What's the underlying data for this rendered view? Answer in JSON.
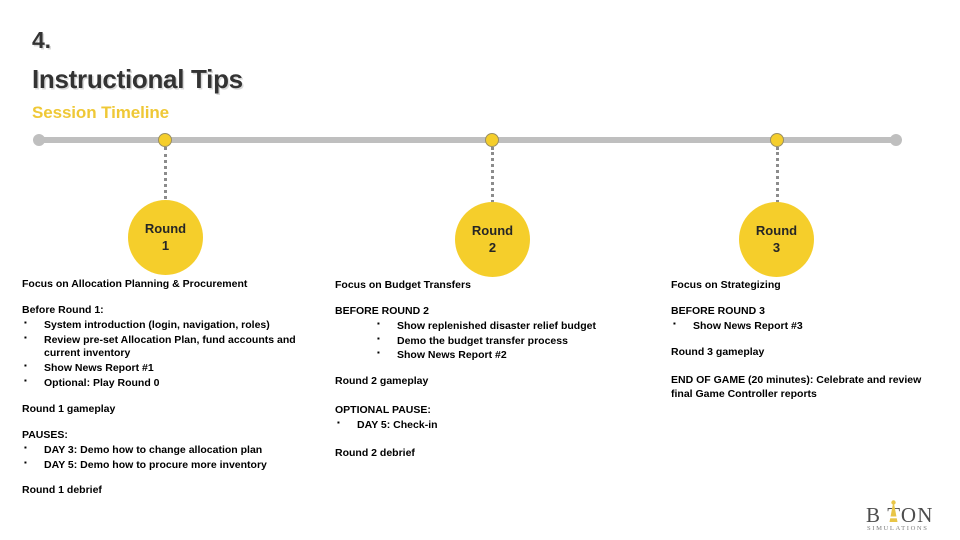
{
  "header": {
    "number": "4.",
    "title": "Instructional Tips",
    "subtitle": "Session Timeline",
    "accent_color": "#EFC836",
    "title_color": "#333333"
  },
  "timeline": {
    "bar_color": "#BFBFBF",
    "node_color": "#F5CE2B",
    "nodes": [
      {
        "label_line1": "Round",
        "label_line2": "1"
      },
      {
        "label_line1": "Round",
        "label_line2": "2"
      },
      {
        "label_line1": "Round",
        "label_line2": "3"
      }
    ]
  },
  "columns": {
    "round1": {
      "focus": "Focus on Allocation Planning & Procurement",
      "before_heading": "Before Round 1:",
      "before_bullets": [
        "System introduction (login, navigation, roles)",
        "Review pre-set Allocation Plan, fund accounts and current inventory",
        "Show News Report #1",
        "Optional: Play Round 0"
      ],
      "gameplay": "Round 1 gameplay",
      "pauses_heading": "PAUSES:",
      "pauses_bullets": [
        "DAY 3: Demo how to change allocation plan",
        "DAY 5: Demo how to procure more inventory"
      ],
      "debrief": "Round 1 debrief"
    },
    "round2": {
      "focus": "Focus on Budget Transfers",
      "before_heading": "BEFORE ROUND 2",
      "before_bullets": [
        "Show replenished disaster relief budget",
        "Demo the budget transfer process",
        "Show News Report #2"
      ],
      "gameplay": "Round 2 gameplay",
      "pauses_heading": "OPTIONAL PAUSE:",
      "pauses_bullets": [
        "DAY 5: Check-in"
      ],
      "debrief": "Round 2 debrief"
    },
    "round3": {
      "focus": "Focus on Strategizing",
      "before_heading": "BEFORE ROUND 3",
      "before_bullets": [
        "Show  News Report #3"
      ],
      "gameplay": "Round 3 gameplay",
      "end_of_game": "END OF GAME (20 minutes): Celebrate and review final Game Controller reports"
    }
  },
  "logo": {
    "word": "B TON",
    "tagline": "SIMULATIONS",
    "mark_color": "#E8C547"
  }
}
